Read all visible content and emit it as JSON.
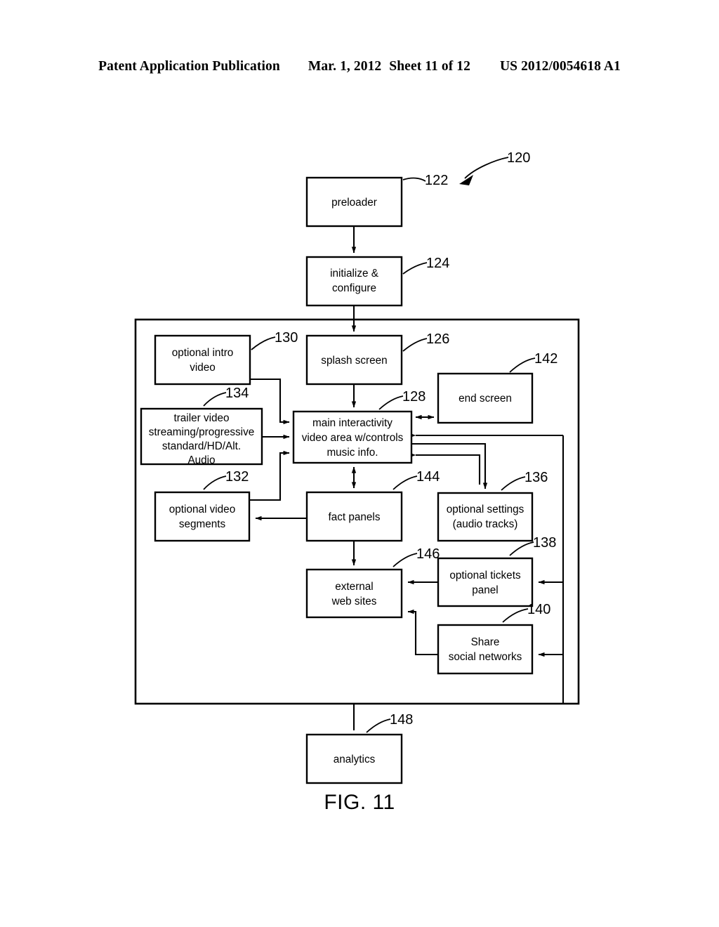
{
  "header": {
    "publication": "Patent Application Publication",
    "date": "Mar. 1, 2012",
    "sheet": "Sheet 11 of 12",
    "number": "US 2012/0054618 A1"
  },
  "figure": {
    "caption": "FIG. 11",
    "system_ref": "120"
  },
  "nodes": {
    "preloader": {
      "label": "preloader",
      "ref": "122"
    },
    "initialize": {
      "label_line1": "initialize &",
      "label_line2": "configure",
      "ref": "124"
    },
    "splash": {
      "label": "splash screen",
      "ref": "126"
    },
    "intro": {
      "label_line1": "optional intro",
      "label_line2": "video",
      "ref": "130"
    },
    "trailer": {
      "label_line1": "trailer video",
      "label_line2": "streaming/progressive",
      "label_line3": "standard/HD/Alt.",
      "label_line4": "Audio",
      "ref": "134"
    },
    "main": {
      "label_line1": "main interactivity",
      "label_line2": "video area w/controls",
      "label_line3": "music info.",
      "ref": "128"
    },
    "endscreen": {
      "label": "end screen",
      "ref": "142"
    },
    "segments": {
      "label_line1": "optional video",
      "label_line2": "segments",
      "ref": "132"
    },
    "factpanels": {
      "label": "fact panels",
      "ref": "144"
    },
    "settings": {
      "label_line1": "optional settings",
      "label_line2": "(audio tracks)",
      "ref": "136"
    },
    "external": {
      "label_line1": "external",
      "label_line2": "web sites",
      "ref": "146"
    },
    "tickets": {
      "label_line1": "optional tickets",
      "label_line2": "panel",
      "ref": "138"
    },
    "share": {
      "label_line1": "Share",
      "label_line2": "social networks",
      "ref": "140"
    },
    "analytics": {
      "label": "analytics",
      "ref": "148"
    }
  },
  "colors": {
    "stroke": "#000000",
    "background": "#ffffff"
  }
}
